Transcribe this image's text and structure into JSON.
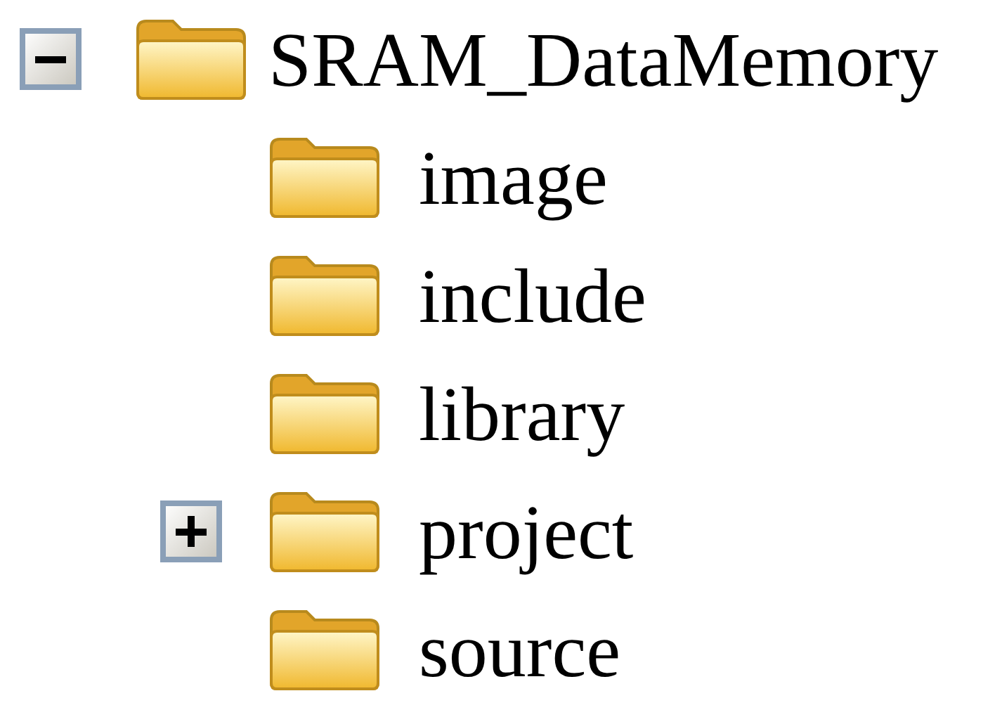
{
  "tree": {
    "label": "SRAM_DataMemory",
    "expanded": true,
    "children": [
      {
        "label": "image"
      },
      {
        "label": "include"
      },
      {
        "label": "library"
      },
      {
        "label": "project",
        "expanded": false
      },
      {
        "label": "source"
      }
    ]
  }
}
